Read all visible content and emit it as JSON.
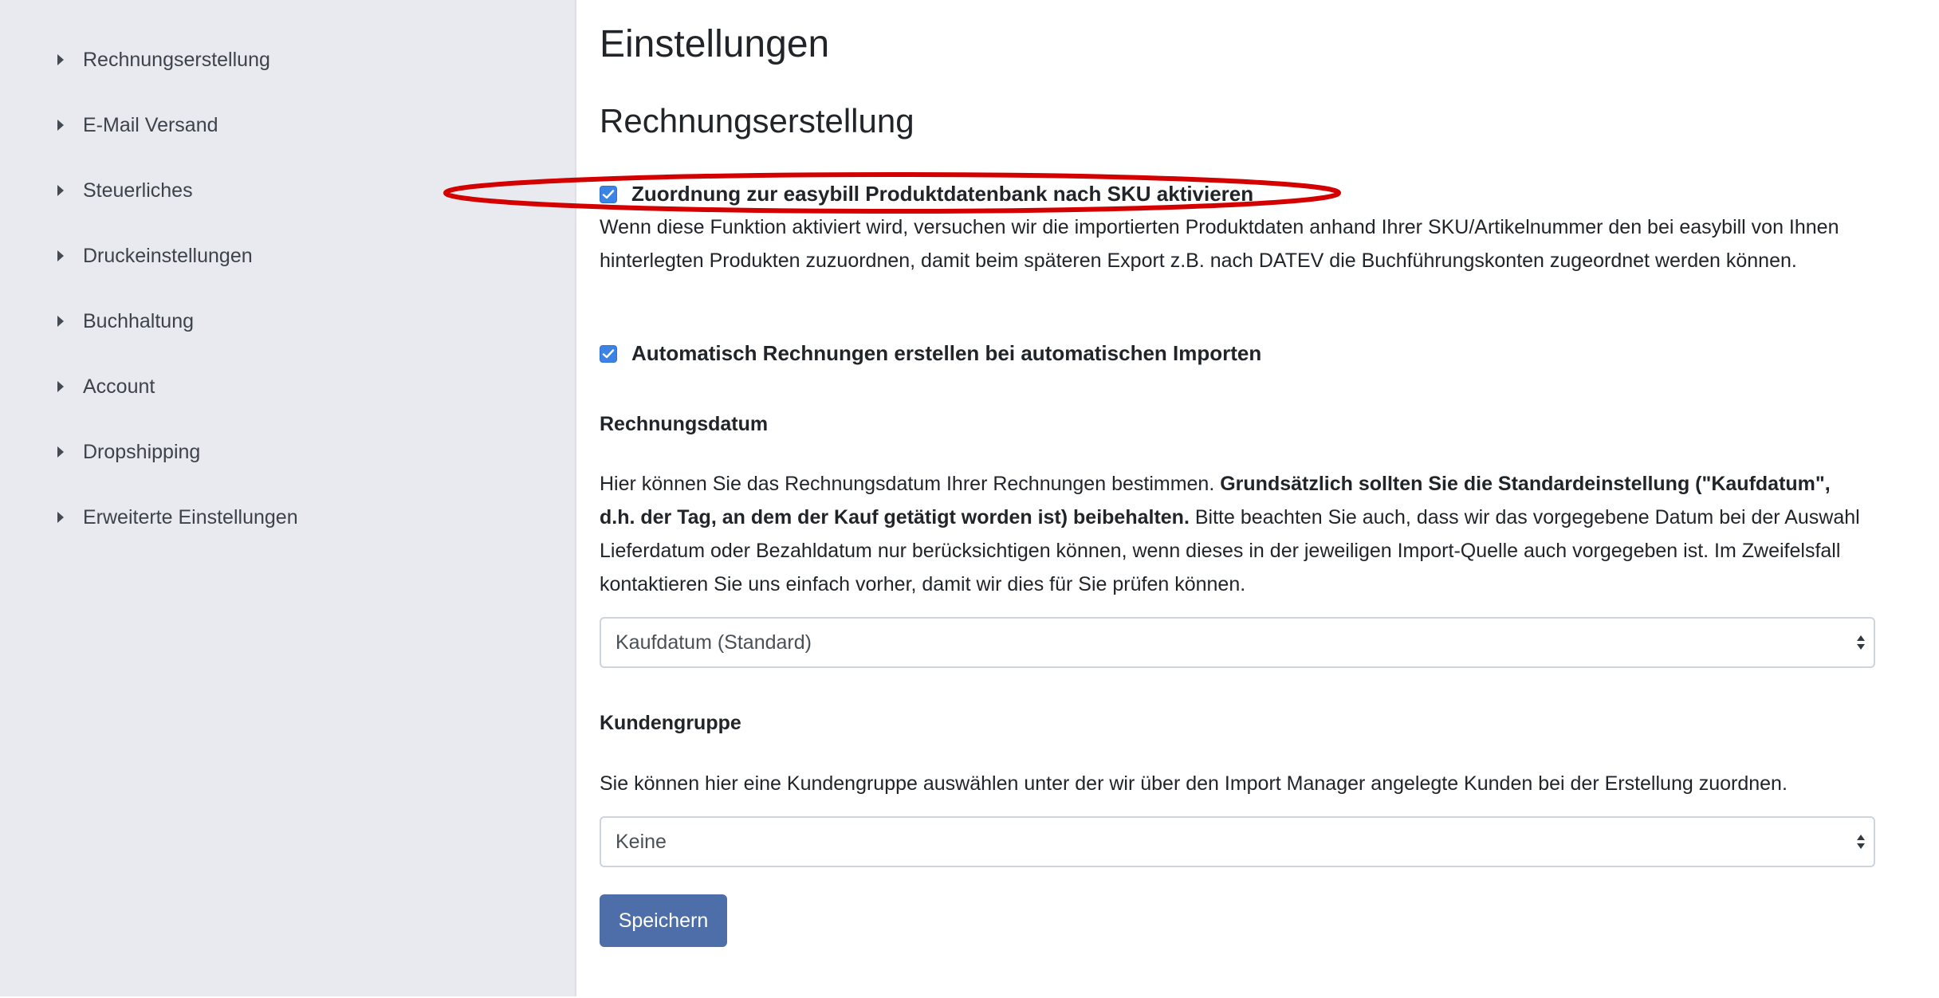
{
  "sidebar": {
    "items": [
      {
        "label": "Rechnungserstellung"
      },
      {
        "label": "E-Mail Versand"
      },
      {
        "label": "Steuerliches"
      },
      {
        "label": "Druckeinstellungen"
      },
      {
        "label": "Buchhaltung"
      },
      {
        "label": "Account"
      },
      {
        "label": "Dropshipping"
      },
      {
        "label": "Erweiterte Einstellungen"
      }
    ]
  },
  "main": {
    "title": "Einstellungen",
    "section_title": "Rechnungserstellung",
    "sku_option": {
      "label": "Zuordnung zur easybill Produktdatenbank nach SKU aktivieren",
      "checked": true,
      "description": "Wenn diese Funktion aktiviert wird, versuchen wir die importierten Produktdaten anhand Ihrer SKU/Artikelnummer den bei easybill von Ihnen hinterlegten Produkten zuzuordnen, damit beim späteren Export z.B. nach DATEV die Buchführungskonten zugeordnet werden können."
    },
    "auto_invoice_option": {
      "label": "Automatisch Rechnungen erstellen bei automatischen Importen",
      "checked": true
    },
    "invoice_date": {
      "heading": "Rechnungsdatum",
      "text_part1": "Hier können Sie das Rechnungsdatum Ihrer Rechnungen bestimmen. ",
      "text_bold": "Grundsätzlich sollten Sie die Standardeinstellung (\"Kaufdatum\", d.h. der Tag, an dem der Kauf getätigt worden ist) beibehalten.",
      "text_part2": " Bitte beachten Sie auch, dass wir das vorgegebene Datum bei der Auswahl Lieferdatum oder Bezahldatum nur berücksichtigen können, wenn dieses in der jeweiligen Import-Quelle auch vorgegeben ist. Im Zweifelsfall kontaktieren Sie uns einfach vorher, damit wir dies für Sie prüfen können.",
      "selected": "Kaufdatum (Standard)"
    },
    "customer_group": {
      "heading": "Kundengruppe",
      "text": "Sie können hier eine Kundengruppe auswählen unter der wir über den Import Manager angelegte Kunden bei der Erstellung zuordnen.",
      "selected": "Keine"
    },
    "save_label": "Speichern"
  },
  "colors": {
    "sidebar_bg": "#e9eaf0",
    "checkbox": "#3b84e6",
    "button": "#4d6ea8",
    "annotation": "#d40000"
  },
  "icons": {
    "nav_item": "caret-right-icon",
    "checkbox": "checkmark-icon",
    "select": "select-arrows-icon"
  }
}
